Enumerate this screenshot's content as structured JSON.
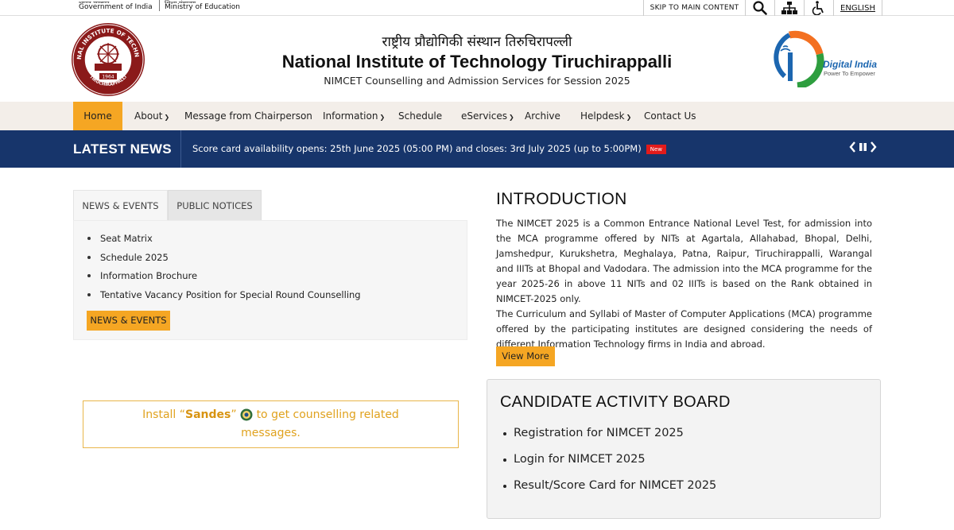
{
  "gov_bar": {
    "left_hi": "भारत सरकार",
    "left_en": "Government of India",
    "right_hi": "शिक्षा मंत्रालय",
    "right_en": "Ministry of Education",
    "skip_label": "SKIP TO MAIN CONTENT",
    "language": "ENGLISH",
    "icons": [
      "search-icon",
      "sitemap-icon",
      "accessibility-icon"
    ]
  },
  "header": {
    "title_hindi": "राष्ट्रीय प्रौद्योगिकी संस्थान तिरुचिरापल्ली",
    "title": "National Institute of Technology Tiruchirappalli",
    "subtitle": "NIMCET Counselling and Admission Services for Session 2025",
    "logo": {
      "ring_text": "NATIONAL INSTITUTE OF TECHNOLOGY",
      "bottom_text": "TIRUCHIRAPPALLI",
      "year": "1964"
    },
    "digital_india": {
      "title": "Digital India",
      "tagline": "Power To Empower"
    }
  },
  "nav": {
    "items": [
      {
        "label": "Home",
        "active": true,
        "dropdown": false
      },
      {
        "label": "About",
        "dropdown": true
      },
      {
        "label": "Message from Chairperson",
        "dropdown": false
      },
      {
        "label": "Information",
        "dropdown": true
      },
      {
        "label": "Schedule",
        "dropdown": false
      },
      {
        "label": "eServices",
        "dropdown": true
      },
      {
        "label": "Archive",
        "dropdown": false
      },
      {
        "label": "Helpdesk",
        "dropdown": true
      },
      {
        "label": "Contact Us",
        "dropdown": false
      }
    ]
  },
  "latest_news": {
    "label": "LATEST NEWS",
    "item": "Score card availability opens: 25th June 2025 (05:00 PM) and closes: 3rd July 2025 (up to 5:00PM)",
    "badge": "New"
  },
  "tabs": {
    "tab1": "NEWS & EVENTS",
    "tab2": "PUBLIC NOTICES",
    "items": [
      "Seat Matrix",
      "Schedule 2025",
      "Information Brochure",
      "Tentative Vacancy Position for Special Round Counselling"
    ],
    "button": "NEWS & EVENTS"
  },
  "sandes": {
    "prefix": "Install “",
    "app": "Sandes",
    "middle": "”",
    "suffix": "to get counselling related",
    "line2": "messages."
  },
  "intro": {
    "heading": "INTRODUCTION",
    "p1": "The NIMCET 2025 is a Common Entrance National Level Test, for admission into the MCA programme offered by NITs at Agartala, Allahabad, Bhopal, Delhi, Jamshedpur, Kurukshetra, Meghalaya, Patna, Raipur, Tiruchirappalli, Warangal and IIITs at Bhopal and Vadodara. The admission into the MCA programme for the year 2025-26 in above 11 NITs and 02 IIITs is based on the Rank obtained in NIMCET-2025 only.",
    "p2": "The Curriculum and Syllabi of Master of Computer Applications (MCA) programme offered by the participating institutes are designed considering the needs of different Information Technology firms in India and abroad.",
    "button": "View More"
  },
  "board": {
    "heading": "CANDIDATE ACTIVITY BOARD",
    "items": [
      "Registration for NIMCET 2025",
      "Login for NIMCET 2025",
      "Result/Score Card for NIMCET 2025"
    ]
  },
  "colors": {
    "accent_orange": "#f5a623",
    "news_bar": "#17356b",
    "nav_bg": "#f3eee9",
    "new_badge": "#e21b1b"
  }
}
